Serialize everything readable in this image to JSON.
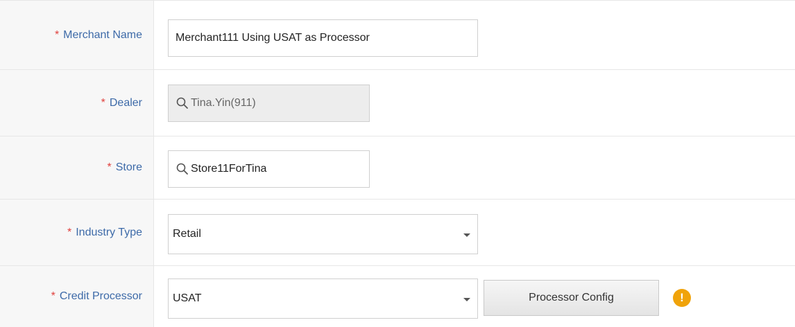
{
  "form": {
    "merchant_name": {
      "label": "Merchant Name",
      "required_marker": "*",
      "value": "Merchant111 Using USAT as Processor"
    },
    "dealer": {
      "label": "Dealer",
      "required_marker": "*",
      "value": "Tina.Yin(911)",
      "icon": "search-icon",
      "disabled": true
    },
    "store": {
      "label": "Store",
      "required_marker": "*",
      "value": "Store11ForTina",
      "icon": "search-icon"
    },
    "industry_type": {
      "label": "Industry Type",
      "required_marker": "*",
      "selected": "Retail",
      "icon": "chevron-down-icon"
    },
    "credit_processor": {
      "label": "Credit Processor",
      "required_marker": "*",
      "selected": "USAT",
      "icon": "chevron-down-icon",
      "config_button_label": "Processor Config",
      "warning_icon": "warning-icon",
      "warning_glyph": "!"
    }
  },
  "colors": {
    "label_text": "#3d6aa8",
    "required": "#e0403d",
    "warning": "#f0a30a"
  }
}
